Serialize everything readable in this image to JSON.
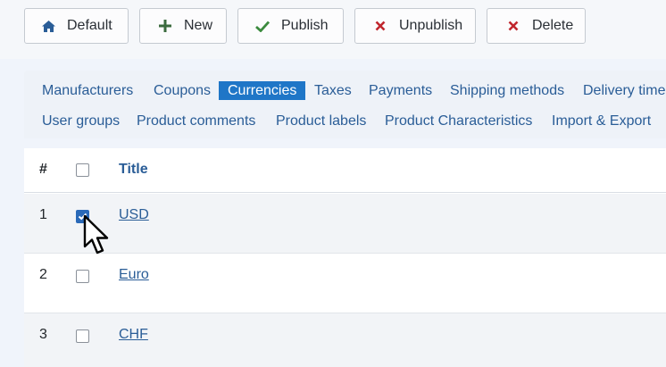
{
  "toolbar": {
    "buttons": [
      {
        "label": "Default",
        "icon": "home-icon"
      },
      {
        "label": "New",
        "icon": "plus-icon"
      },
      {
        "label": "Publish",
        "icon": "check-icon"
      },
      {
        "label": "Unpublish",
        "icon": "x-icon"
      },
      {
        "label": "Delete",
        "icon": "x-icon"
      }
    ]
  },
  "submenu": {
    "row1": [
      "Manufacturers",
      "Coupons",
      "Currencies",
      "Taxes",
      "Payments",
      "Shipping methods",
      "Delivery time"
    ],
    "row2": [
      "User groups",
      "Product comments",
      "Product labels",
      "Product Characteristics",
      "Import & Export"
    ],
    "active": "Currencies"
  },
  "table": {
    "headers": {
      "num": "#",
      "title": "Title"
    },
    "rows": [
      {
        "num": "1",
        "title": "USD",
        "checked": true
      },
      {
        "num": "2",
        "title": "Euro",
        "checked": false
      },
      {
        "num": "3",
        "title": "CHF",
        "checked": false
      }
    ]
  },
  "colors": {
    "accent": "#1f76c7",
    "link": "#2a5d97",
    "publish_green": "#3b8a3e",
    "delete_red": "#c0262d"
  }
}
